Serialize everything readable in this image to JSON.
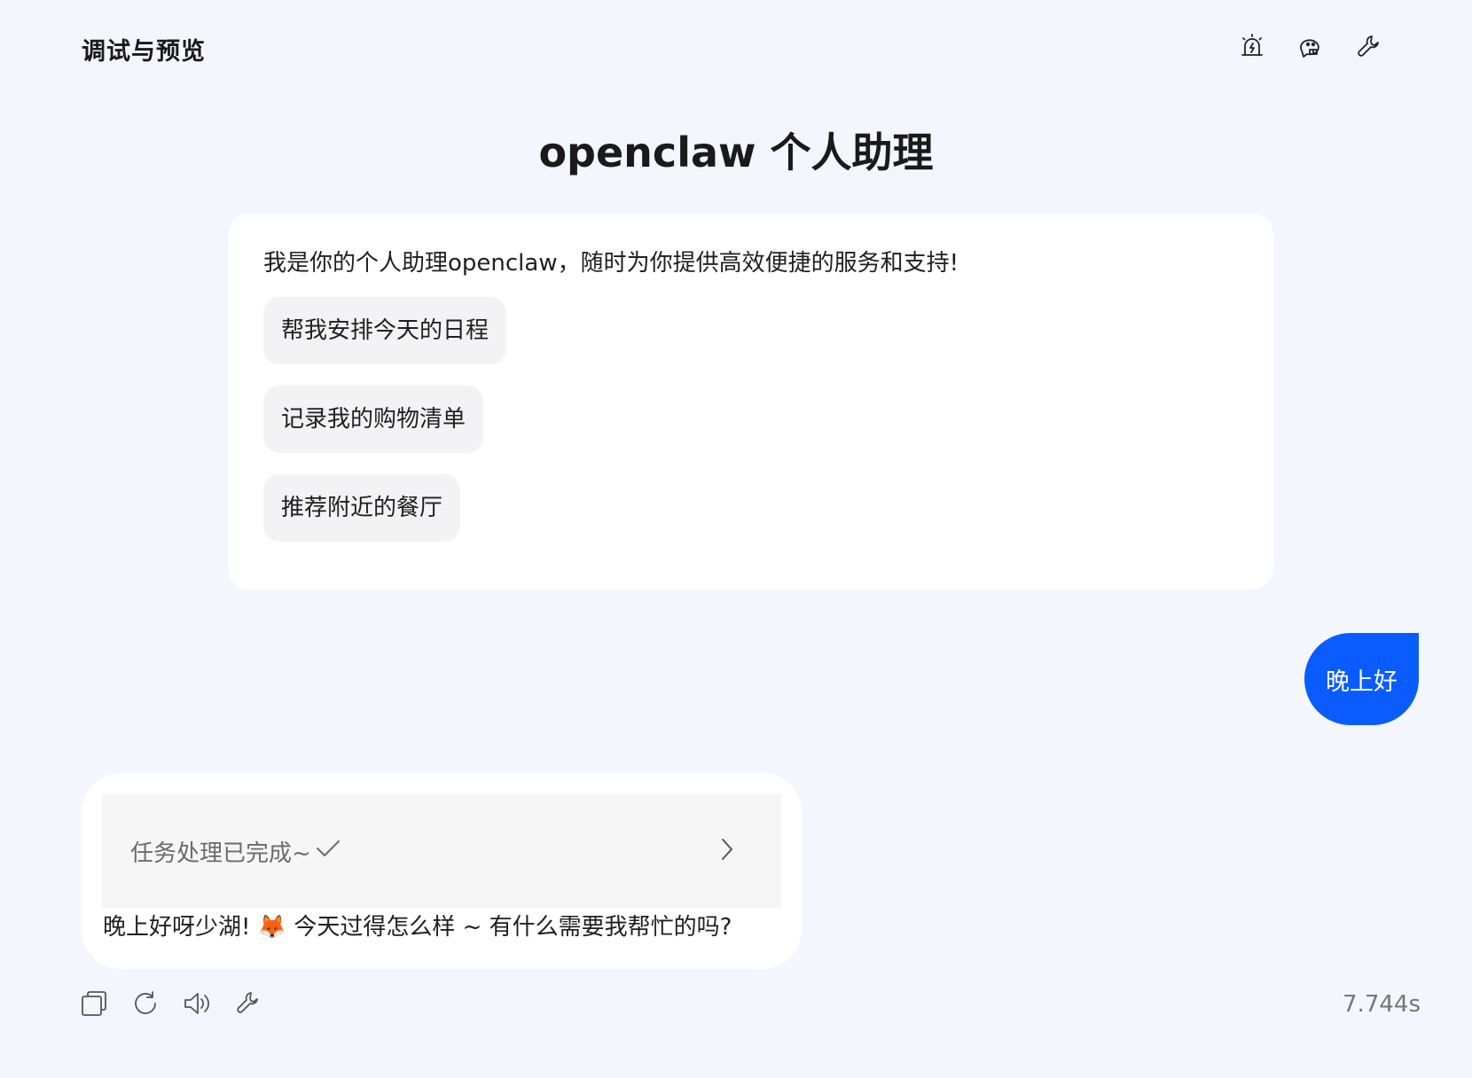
{
  "header": {
    "title": "调试与预览",
    "actions": [
      {
        "name": "alert-lamp-icon",
        "label": ""
      },
      {
        "name": "robot-chat-icon",
        "label": ""
      },
      {
        "name": "wrench-icon",
        "label": ""
      }
    ]
  },
  "bot": {
    "title": "openclaw 个人助理"
  },
  "welcome": {
    "text": "我是你的个人助理openclaw，随时为你提供高效便捷的服务和支持!",
    "suggestions": [
      "帮我安排今天的日程",
      "记录我的购物清单",
      "推荐附近的餐厅"
    ]
  },
  "user_message": {
    "text": "晚上好"
  },
  "bot_reply": {
    "task_status": "任务处理已完成~",
    "text": "晚上好呀少湖! 🦊 今天过得怎么样 ~ 有什么需要我帮忙的吗?"
  },
  "action_bar": {
    "icons": [
      "copy-icon",
      "refresh-icon",
      "speaker-icon",
      "wrench-icon"
    ],
    "elapsed": "7.744s"
  },
  "colors": {
    "background": "#f3f6fd",
    "accent": "#0a5cff",
    "card": "#ffffff",
    "suggestion_bg": "#f3f3f5"
  }
}
